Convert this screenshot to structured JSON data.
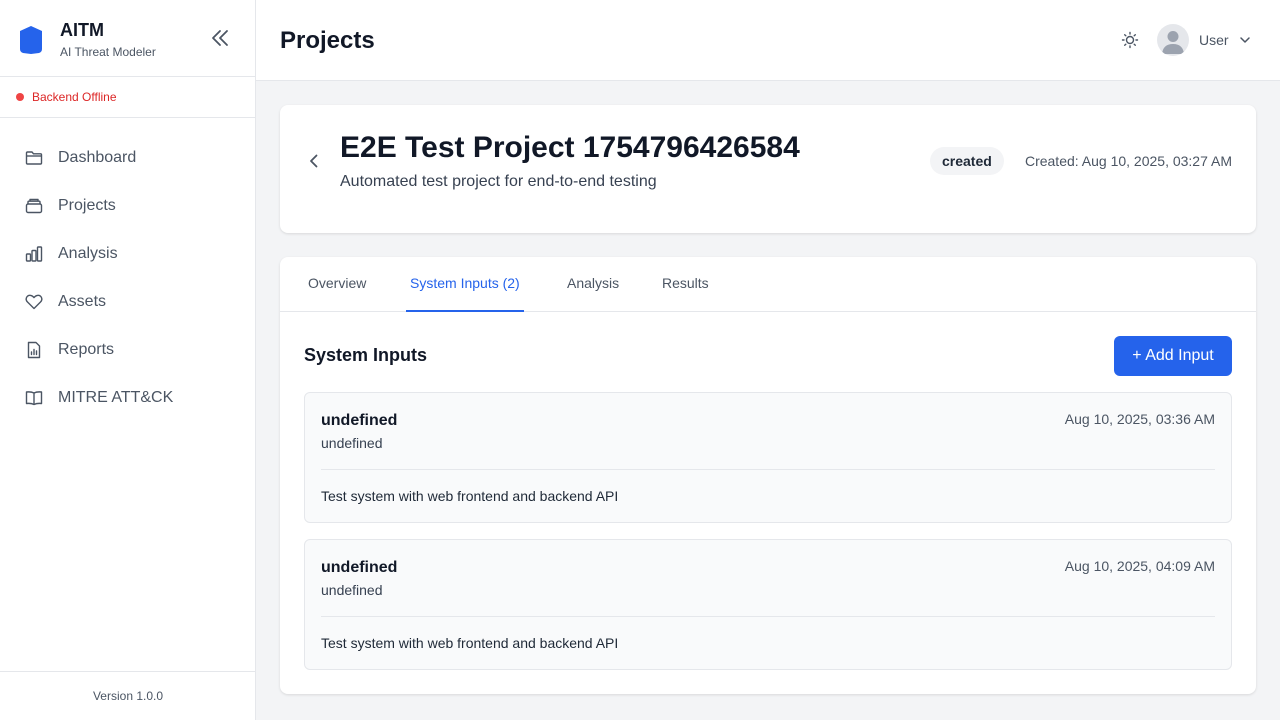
{
  "app": {
    "name": "AITM",
    "subtitle": "AI Threat Modeler",
    "status": "Backend Offline",
    "version": "Version 1.0.0"
  },
  "sidebar": {
    "items": [
      {
        "label": "Dashboard",
        "icon": "folder-icon"
      },
      {
        "label": "Projects",
        "icon": "stack-icon"
      },
      {
        "label": "Analysis",
        "icon": "bar-chart-icon"
      },
      {
        "label": "Assets",
        "icon": "heart-icon"
      },
      {
        "label": "Reports",
        "icon": "report-icon"
      },
      {
        "label": "MITRE ATT&CK",
        "icon": "book-icon"
      }
    ]
  },
  "header": {
    "title": "Projects",
    "user": "User"
  },
  "project": {
    "name": "E2E Test Project 1754796426584",
    "description": "Automated test project for end-to-end testing",
    "status": "created",
    "created": "Created: Aug 10, 2025, 03:27 AM"
  },
  "tabs": [
    {
      "label": "Overview",
      "active": false
    },
    {
      "label": "System Inputs (2)",
      "active": true
    },
    {
      "label": "Analysis",
      "active": false
    },
    {
      "label": "Results",
      "active": false
    }
  ],
  "system_inputs": {
    "title": "System Inputs",
    "add_label": "+ Add Input",
    "items": [
      {
        "title": "undefined",
        "type": "undefined",
        "date": "Aug 10, 2025, 03:36 AM",
        "description": "Test system with web frontend and backend API"
      },
      {
        "title": "undefined",
        "type": "undefined",
        "date": "Aug 10, 2025, 04:09 AM",
        "description": "Test system with web frontend and backend API"
      }
    ]
  },
  "colors": {
    "accent": "#2563eb",
    "offline": "#dc2626"
  }
}
